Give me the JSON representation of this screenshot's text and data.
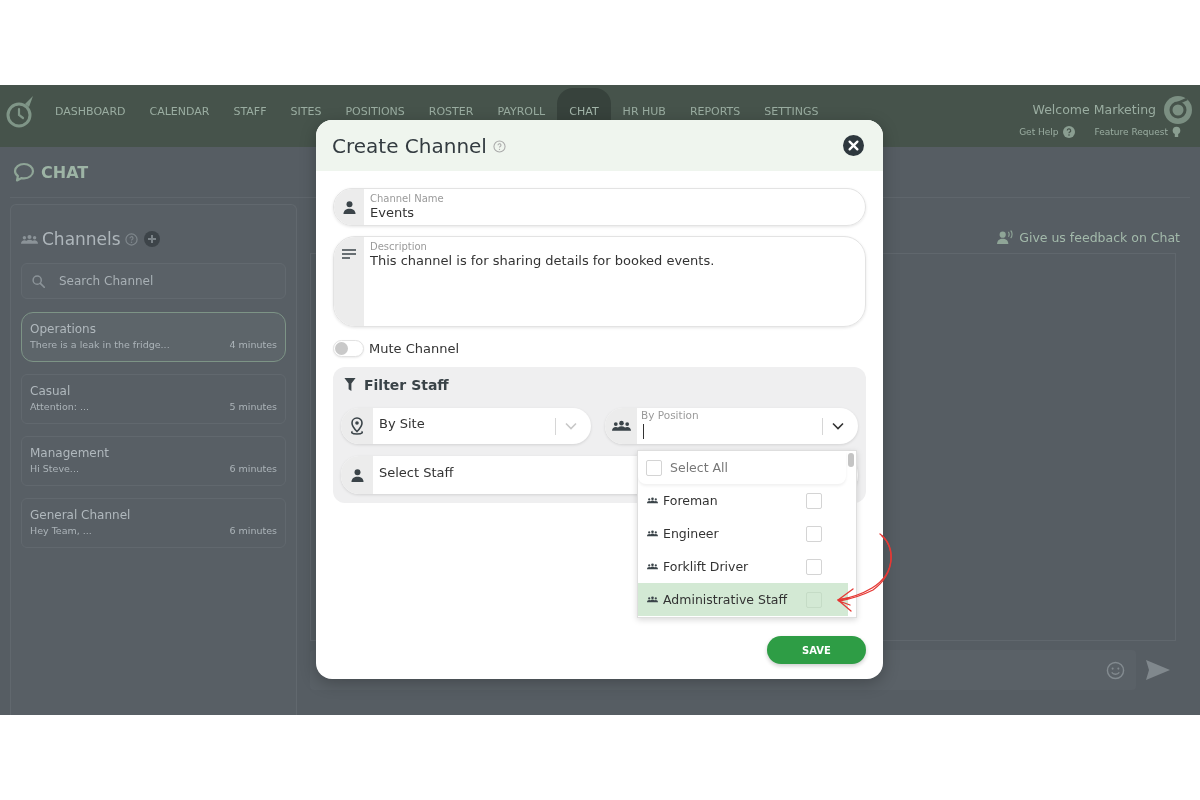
{
  "top_bar": {
    "nav_items": [
      {
        "label": "DASHBOARD",
        "selected": false
      },
      {
        "label": "CALENDAR",
        "selected": false
      },
      {
        "label": "STAFF",
        "selected": false
      },
      {
        "label": "SITES",
        "selected": false
      },
      {
        "label": "POSITIONS",
        "selected": false
      },
      {
        "label": "ROSTER",
        "selected": false
      },
      {
        "label": "PAYROLL",
        "selected": false
      },
      {
        "label": "CHAT",
        "selected": true
      },
      {
        "label": "HR HUB",
        "selected": false
      },
      {
        "label": "REPORTS",
        "selected": false
      },
      {
        "label": "SETTINGS",
        "selected": false
      }
    ],
    "welcome": "Welcome Marketing",
    "links": [
      {
        "label": "Get Help",
        "kind": "help"
      },
      {
        "label": "Feature Request",
        "kind": "idea"
      }
    ]
  },
  "page": {
    "title": "CHAT"
  },
  "channels_panel": {
    "title": "Channels",
    "search": {
      "placeholder": "Search Channel"
    },
    "channels": [
      {
        "name": "Operations",
        "preview": "There is a leak in the fridge...",
        "time": "4 minutes",
        "selected": true
      },
      {
        "name": "Casual",
        "preview": "Attention: ...",
        "time": "5 minutes",
        "selected": false
      },
      {
        "name": "Management",
        "preview": "Hi Steve...",
        "time": "6 minutes",
        "selected": false
      },
      {
        "name": "General Channel",
        "preview": "Hey Team, ...",
        "time": "6 minutes",
        "selected": false
      }
    ]
  },
  "chat_panel": {
    "feedback_link": "Give us feedback on Chat"
  },
  "dialog": {
    "title": "Create Channel",
    "channel_name": {
      "label": "Channel Name",
      "value": "Events"
    },
    "description": {
      "label": "Description",
      "value": "This channel is for sharing details for booked events."
    },
    "mute": {
      "label": "Mute Channel",
      "on": false
    },
    "filter": {
      "title": "Filter Staff",
      "site": {
        "label": "By Site",
        "focused": false
      },
      "position": {
        "label": "By Position",
        "focused": true,
        "expanded": true,
        "select_all": {
          "label": "Select All",
          "checked": false
        },
        "options": [
          {
            "label": "Foreman",
            "checked": false,
            "highlighted": false
          },
          {
            "label": "Engineer",
            "checked": false,
            "highlighted": false
          },
          {
            "label": "Forklift Driver",
            "checked": false,
            "highlighted": false
          },
          {
            "label": "Administrative Staff",
            "checked": false,
            "highlighted": true
          }
        ]
      },
      "staff": {
        "label": "Select Staff"
      }
    },
    "save_button": "SAVE"
  }
}
